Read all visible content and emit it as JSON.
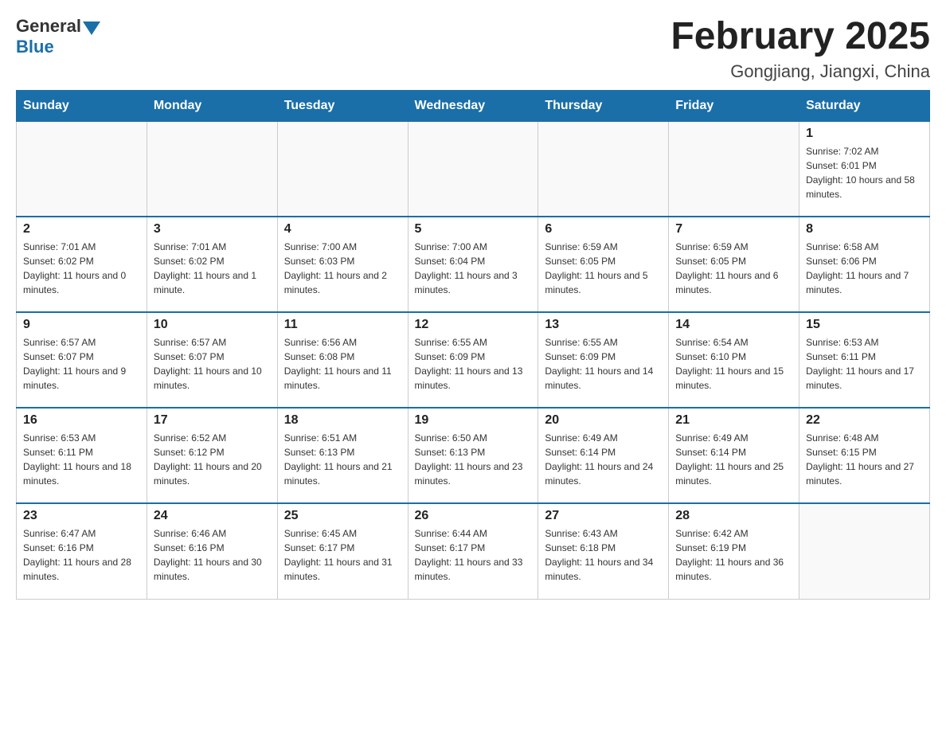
{
  "header": {
    "logo": {
      "general": "General",
      "triangle": "▲",
      "blue": "Blue"
    },
    "title": "February 2025",
    "subtitle": "Gongjiang, Jiangxi, China"
  },
  "days_of_week": [
    "Sunday",
    "Monday",
    "Tuesday",
    "Wednesday",
    "Thursday",
    "Friday",
    "Saturday"
  ],
  "weeks": [
    [
      {
        "day": "",
        "info": ""
      },
      {
        "day": "",
        "info": ""
      },
      {
        "day": "",
        "info": ""
      },
      {
        "day": "",
        "info": ""
      },
      {
        "day": "",
        "info": ""
      },
      {
        "day": "",
        "info": ""
      },
      {
        "day": "1",
        "info": "Sunrise: 7:02 AM\nSunset: 6:01 PM\nDaylight: 10 hours and 58 minutes."
      }
    ],
    [
      {
        "day": "2",
        "info": "Sunrise: 7:01 AM\nSunset: 6:02 PM\nDaylight: 11 hours and 0 minutes."
      },
      {
        "day": "3",
        "info": "Sunrise: 7:01 AM\nSunset: 6:02 PM\nDaylight: 11 hours and 1 minute."
      },
      {
        "day": "4",
        "info": "Sunrise: 7:00 AM\nSunset: 6:03 PM\nDaylight: 11 hours and 2 minutes."
      },
      {
        "day": "5",
        "info": "Sunrise: 7:00 AM\nSunset: 6:04 PM\nDaylight: 11 hours and 3 minutes."
      },
      {
        "day": "6",
        "info": "Sunrise: 6:59 AM\nSunset: 6:05 PM\nDaylight: 11 hours and 5 minutes."
      },
      {
        "day": "7",
        "info": "Sunrise: 6:59 AM\nSunset: 6:05 PM\nDaylight: 11 hours and 6 minutes."
      },
      {
        "day": "8",
        "info": "Sunrise: 6:58 AM\nSunset: 6:06 PM\nDaylight: 11 hours and 7 minutes."
      }
    ],
    [
      {
        "day": "9",
        "info": "Sunrise: 6:57 AM\nSunset: 6:07 PM\nDaylight: 11 hours and 9 minutes."
      },
      {
        "day": "10",
        "info": "Sunrise: 6:57 AM\nSunset: 6:07 PM\nDaylight: 11 hours and 10 minutes."
      },
      {
        "day": "11",
        "info": "Sunrise: 6:56 AM\nSunset: 6:08 PM\nDaylight: 11 hours and 11 minutes."
      },
      {
        "day": "12",
        "info": "Sunrise: 6:55 AM\nSunset: 6:09 PM\nDaylight: 11 hours and 13 minutes."
      },
      {
        "day": "13",
        "info": "Sunrise: 6:55 AM\nSunset: 6:09 PM\nDaylight: 11 hours and 14 minutes."
      },
      {
        "day": "14",
        "info": "Sunrise: 6:54 AM\nSunset: 6:10 PM\nDaylight: 11 hours and 15 minutes."
      },
      {
        "day": "15",
        "info": "Sunrise: 6:53 AM\nSunset: 6:11 PM\nDaylight: 11 hours and 17 minutes."
      }
    ],
    [
      {
        "day": "16",
        "info": "Sunrise: 6:53 AM\nSunset: 6:11 PM\nDaylight: 11 hours and 18 minutes."
      },
      {
        "day": "17",
        "info": "Sunrise: 6:52 AM\nSunset: 6:12 PM\nDaylight: 11 hours and 20 minutes."
      },
      {
        "day": "18",
        "info": "Sunrise: 6:51 AM\nSunset: 6:13 PM\nDaylight: 11 hours and 21 minutes."
      },
      {
        "day": "19",
        "info": "Sunrise: 6:50 AM\nSunset: 6:13 PM\nDaylight: 11 hours and 23 minutes."
      },
      {
        "day": "20",
        "info": "Sunrise: 6:49 AM\nSunset: 6:14 PM\nDaylight: 11 hours and 24 minutes."
      },
      {
        "day": "21",
        "info": "Sunrise: 6:49 AM\nSunset: 6:14 PM\nDaylight: 11 hours and 25 minutes."
      },
      {
        "day": "22",
        "info": "Sunrise: 6:48 AM\nSunset: 6:15 PM\nDaylight: 11 hours and 27 minutes."
      }
    ],
    [
      {
        "day": "23",
        "info": "Sunrise: 6:47 AM\nSunset: 6:16 PM\nDaylight: 11 hours and 28 minutes."
      },
      {
        "day": "24",
        "info": "Sunrise: 6:46 AM\nSunset: 6:16 PM\nDaylight: 11 hours and 30 minutes."
      },
      {
        "day": "25",
        "info": "Sunrise: 6:45 AM\nSunset: 6:17 PM\nDaylight: 11 hours and 31 minutes."
      },
      {
        "day": "26",
        "info": "Sunrise: 6:44 AM\nSunset: 6:17 PM\nDaylight: 11 hours and 33 minutes."
      },
      {
        "day": "27",
        "info": "Sunrise: 6:43 AM\nSunset: 6:18 PM\nDaylight: 11 hours and 34 minutes."
      },
      {
        "day": "28",
        "info": "Sunrise: 6:42 AM\nSunset: 6:19 PM\nDaylight: 11 hours and 36 minutes."
      },
      {
        "day": "",
        "info": ""
      }
    ]
  ]
}
